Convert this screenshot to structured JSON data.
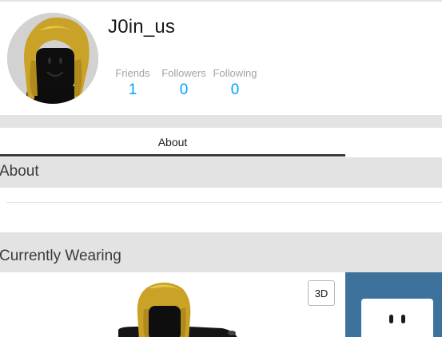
{
  "profile": {
    "username": "J0in_us",
    "stats": [
      {
        "label": "Friends",
        "value": "1"
      },
      {
        "label": "Followers",
        "value": "0"
      },
      {
        "label": "Following",
        "value": "0"
      }
    ]
  },
  "tabs": [
    {
      "label": "About",
      "active": true
    }
  ],
  "about": {
    "title": "About"
  },
  "wearing": {
    "title": "Currently Wearing",
    "view_toggle_label": "3D"
  },
  "colors": {
    "accent": "#00a2ff",
    "band": "#e3e3e3",
    "tab_underline": "#393b3d",
    "asset_panel": "#3c729b"
  }
}
